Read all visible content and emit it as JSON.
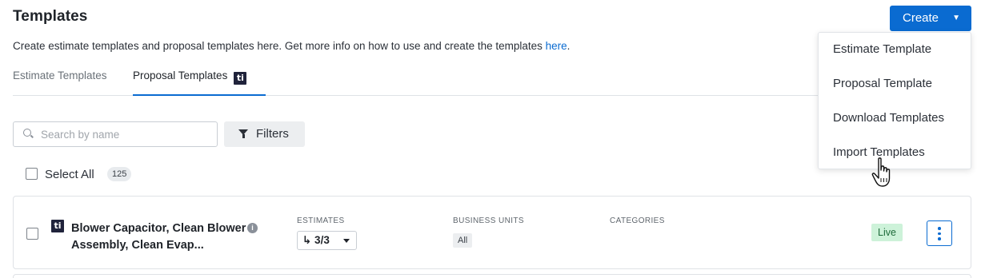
{
  "page": {
    "title": "Templates",
    "description": "Create estimate templates and proposal templates here. Get more info on how to use and create the templates ",
    "description_link": "here",
    "description_end": "."
  },
  "tabs": [
    {
      "label": "Estimate Templates",
      "active": false
    },
    {
      "label": "Proposal Templates",
      "active": true,
      "badge": "ti"
    }
  ],
  "create_menu": {
    "button_label": "Create",
    "items": [
      "Estimate Template",
      "Proposal Template",
      "Download Templates",
      "Import Templates"
    ]
  },
  "toolbar": {
    "search_placeholder": "Search by name",
    "filters_label": "Filters",
    "select_all_label": "Select All",
    "total_count": "125"
  },
  "templates": [
    {
      "badge": "ti",
      "name": "Blower Capacitor, Clean Blower Assembly, Clean Evap...",
      "estimates_label": "ESTIMATES",
      "estimates_value": "↳ 3/3",
      "business_units_label": "BUSINESS UNITS",
      "business_unit": "All",
      "categories_label": "CATEGORIES",
      "status": "Live"
    }
  ],
  "colors": {
    "accent": "#0a6bd1",
    "live_bg": "#cdf2d9",
    "live_text": "#1e6b3a",
    "badge_bg": "#20233b"
  },
  "icons": [
    "search-icon",
    "filter-icon",
    "chevron-down-icon",
    "info-icon",
    "kebab-menu-icon",
    "hand-pointer-icon"
  ]
}
